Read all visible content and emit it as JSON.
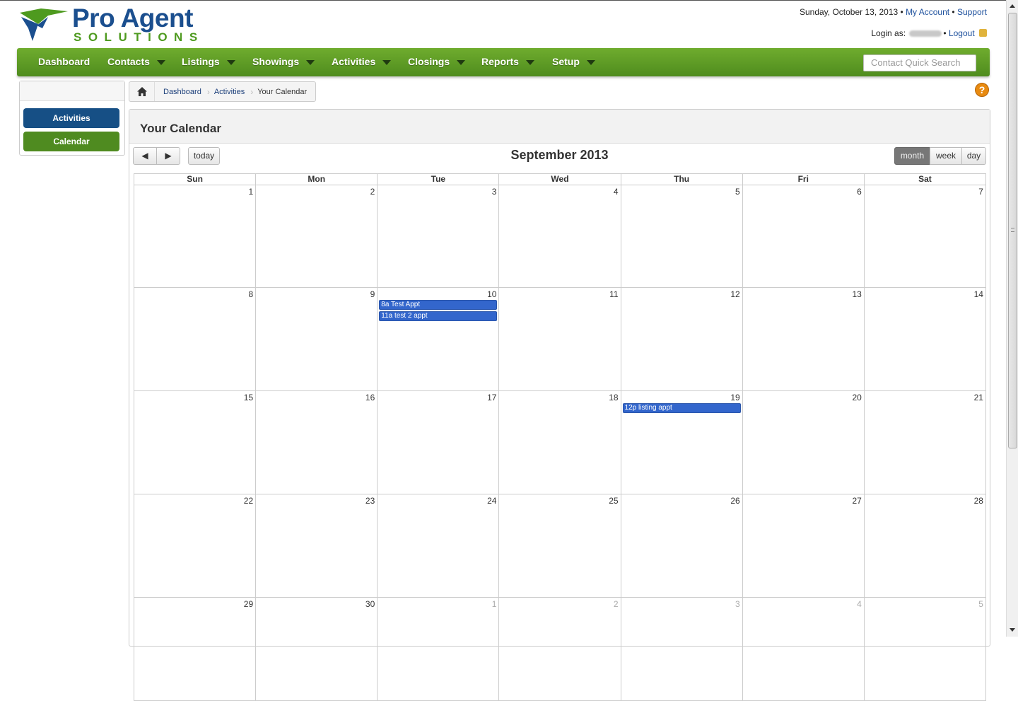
{
  "header": {
    "logo_line1": "Pro Agent",
    "logo_line2": "SOLUTIONS",
    "date_text": "Sunday, October 13, 2013",
    "my_account": "My Account",
    "support": "Support",
    "login_as": "Login as:",
    "logout": "Logout"
  },
  "nav": {
    "items": [
      {
        "label": "Dashboard"
      },
      {
        "label": "Contacts"
      },
      {
        "label": "Listings"
      },
      {
        "label": "Showings"
      },
      {
        "label": "Activities"
      },
      {
        "label": "Closings"
      },
      {
        "label": "Reports"
      },
      {
        "label": "Setup"
      }
    ],
    "quick_search_placeholder": "Contact Quick Search"
  },
  "sidebar": {
    "activities": "Activities",
    "calendar": "Calendar"
  },
  "breadcrumb": {
    "dashboard": "Dashboard",
    "activities": "Activities",
    "current": "Your Calendar"
  },
  "panel": {
    "title": "Your Calendar"
  },
  "calendar": {
    "title": "September 2013",
    "today_label": "today",
    "prev_label": "◀",
    "next_label": "▶",
    "views": {
      "month": "month",
      "week": "week",
      "day": "day"
    },
    "days_of_week": [
      "Sun",
      "Mon",
      "Tue",
      "Wed",
      "Thu",
      "Fri",
      "Sat"
    ],
    "weeks": [
      [
        "1",
        "2",
        "3",
        "4",
        "5",
        "6",
        "7"
      ],
      [
        "8",
        "9",
        "10",
        "11",
        "12",
        "13",
        "14"
      ],
      [
        "15",
        "16",
        "17",
        "18",
        "19",
        "20",
        "21"
      ],
      [
        "22",
        "23",
        "24",
        "25",
        "26",
        "27",
        "28"
      ],
      [
        "29",
        "30",
        "1",
        "2",
        "3",
        "4",
        "5"
      ]
    ],
    "events": [
      {
        "day": "10",
        "label": "8a Test Appt"
      },
      {
        "day": "10",
        "label": "11a test 2 appt"
      },
      {
        "day": "19",
        "label": "12p listing appt"
      }
    ]
  },
  "colors": {
    "nav_green": "#5e9c26",
    "brand_blue": "#1b4f8f",
    "event_blue": "#3366cc",
    "help_orange": "#e88a10"
  }
}
